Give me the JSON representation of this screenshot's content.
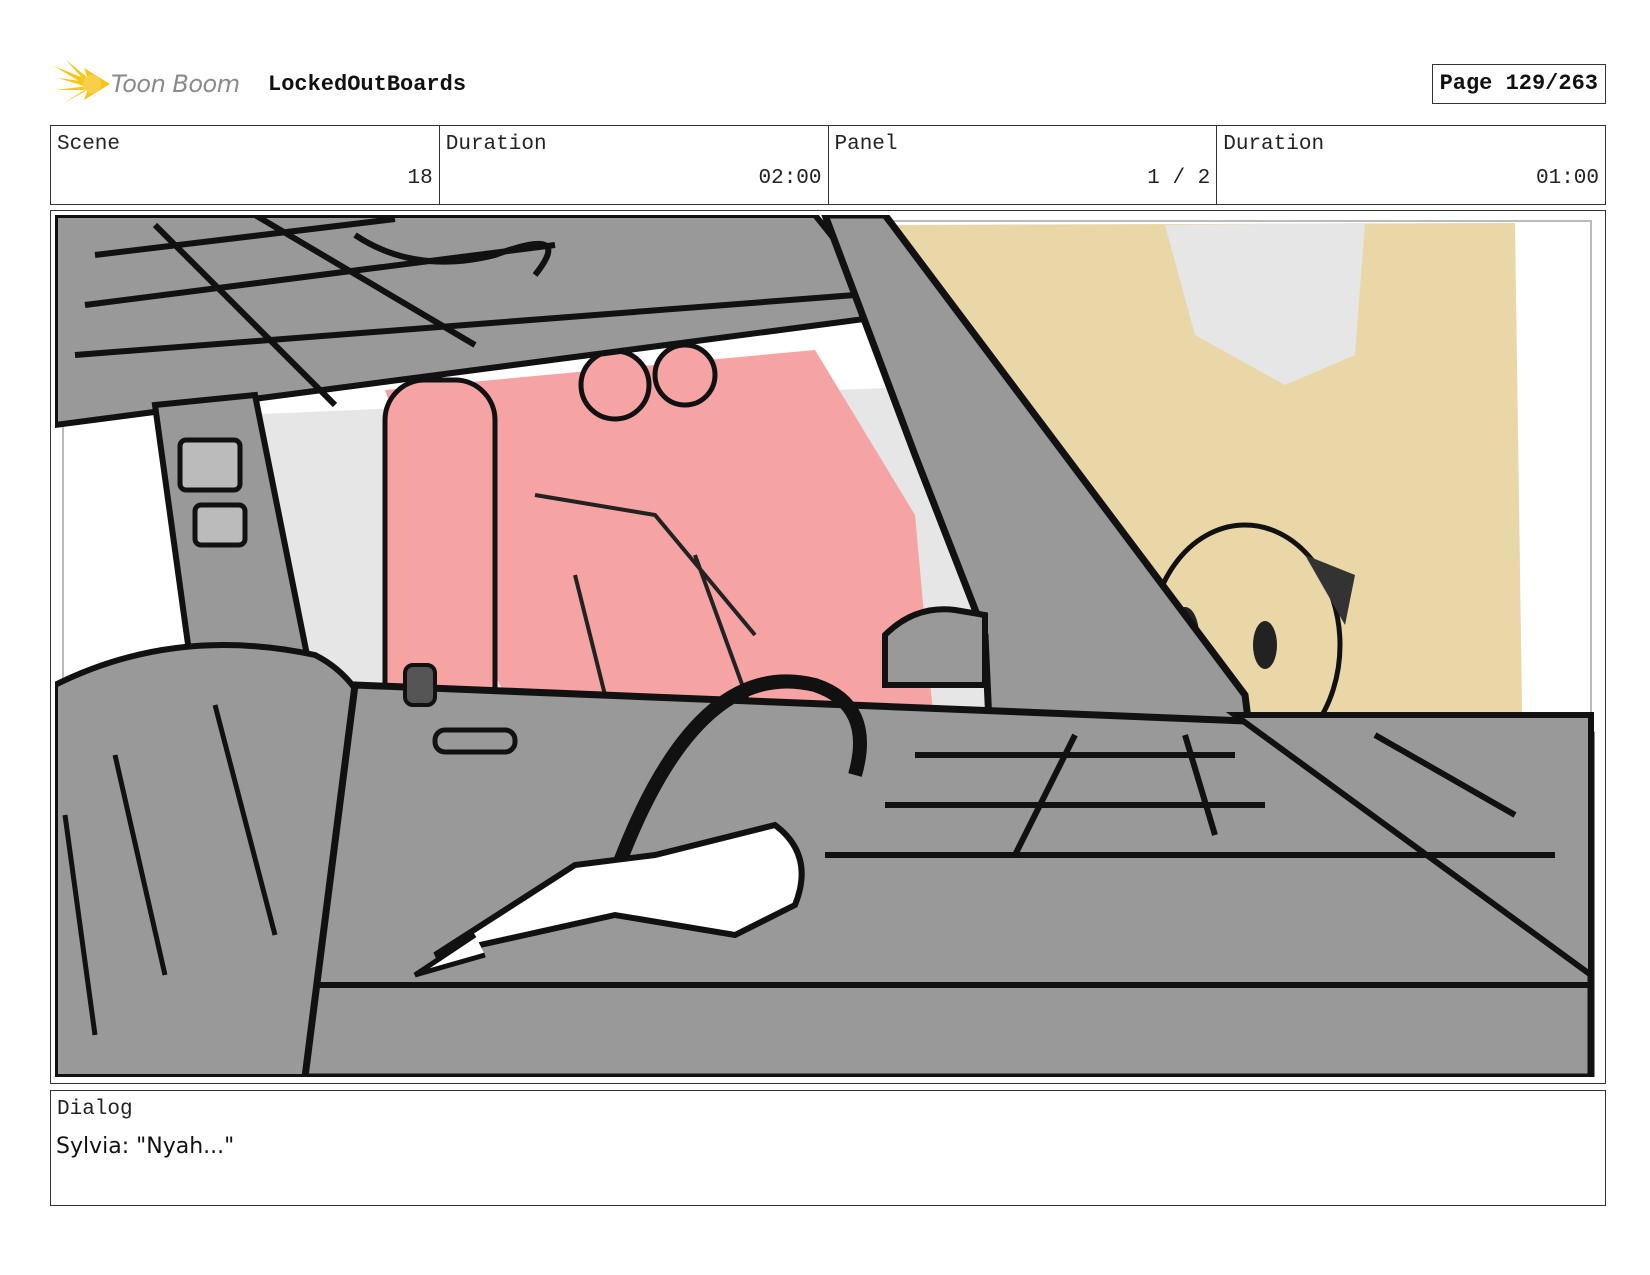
{
  "header": {
    "logo_text": "Toon Boom",
    "project_title": "LockedOutBoards",
    "page_label": "Page 129/263"
  },
  "info": [
    {
      "label": "Scene",
      "value": "18"
    },
    {
      "label": "Duration",
      "value": "02:00"
    },
    {
      "label": "Panel",
      "value": "1 / 2"
    },
    {
      "label": "Duration",
      "value": "01:00"
    }
  ],
  "dialog": {
    "label": "Dialog",
    "text": "Sylvia: \"Nyah...\""
  },
  "colors": {
    "car_gray": "#999999",
    "character_pink": "#f6a3a3",
    "character_blonde": "#ead7a8",
    "window_light": "#e6e6e6",
    "logo_yellow": "#f5c518"
  }
}
